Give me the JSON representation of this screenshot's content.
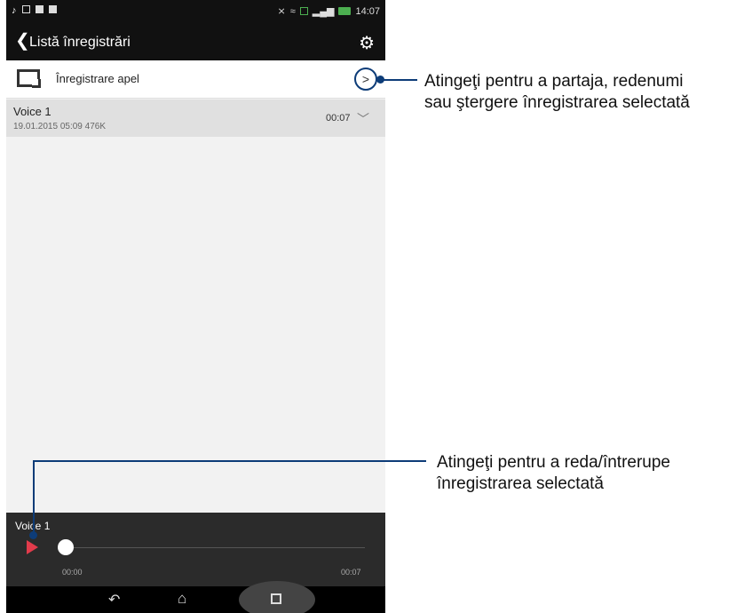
{
  "status": {
    "time": "14:07"
  },
  "appbar": {
    "title": "Listă înregistrări"
  },
  "recording_folder": {
    "label": "Înregistrare apel"
  },
  "item": {
    "title": "Voice 1",
    "meta": "19.01.2015 05:09  476K",
    "duration": "00:07"
  },
  "player": {
    "title": "Voice 1",
    "start": "00:00",
    "end": "00:07"
  },
  "callouts": {
    "share": "Atingeţi pentru a partaja, redenumi\nsau ştergere înregistrarea selectată",
    "play": "Atingeţi pentru a reda/întrerupe\nînregistrarea selectată"
  },
  "icons": {
    "back": "back-icon",
    "settings": "gear-icon",
    "folder": "call-folder-icon",
    "more": "chevron-right-icon",
    "expand": "chevron-down-icon",
    "play": "play-icon",
    "nav_back": "nav-back-icon",
    "nav_home": "nav-home-icon",
    "nav_recent": "nav-recent-icon"
  },
  "colors": {
    "accent": "#0d3c78",
    "play": "#e23b4b"
  }
}
